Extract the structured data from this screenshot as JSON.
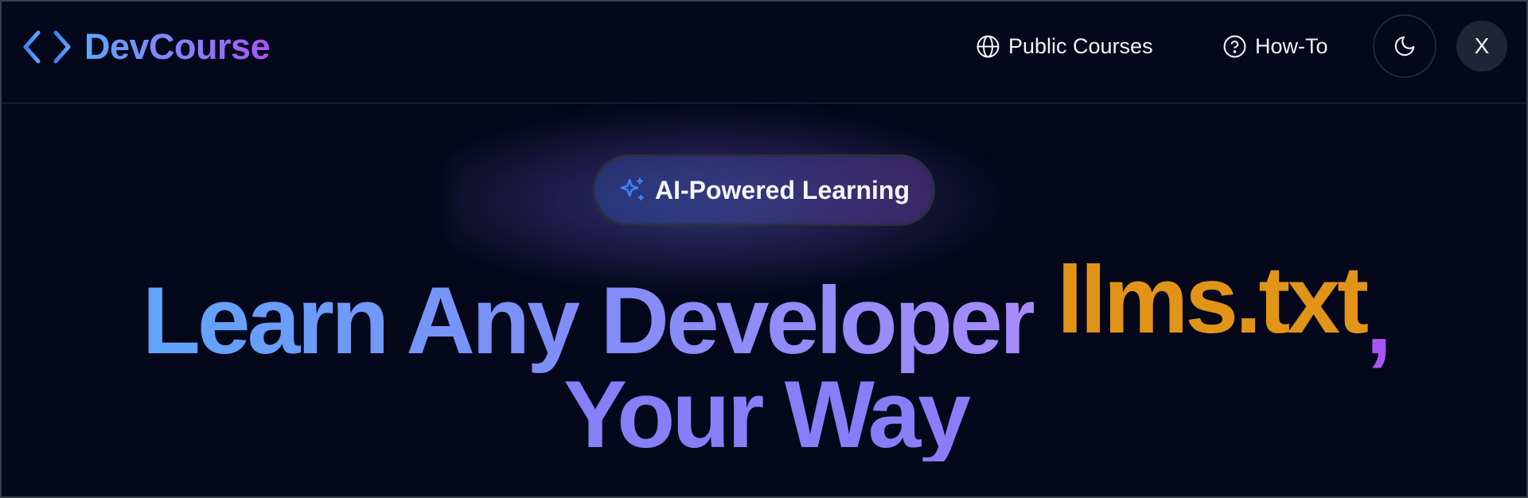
{
  "header": {
    "brand": "DevCourse",
    "nav": {
      "public_courses": "Public Courses",
      "how_to": "How-To"
    },
    "avatar_initial": "X",
    "icons": {
      "logo": "code-brackets-icon",
      "public_courses": "globe-icon",
      "how_to": "help-circle-icon",
      "theme": "moon-icon"
    }
  },
  "hero": {
    "badge": "AI-Powered Learning",
    "badge_icon": "sparkles-icon",
    "headline_part1": "Learn Any Developer",
    "headline_accent": "llms.txt",
    "headline_comma": ",",
    "headline_line2": "Your Way"
  },
  "colors": {
    "background": "#04081a",
    "brand_gradient_start": "#60a5fa",
    "brand_gradient_end": "#a855f7",
    "accent_orange": "#e29418"
  }
}
